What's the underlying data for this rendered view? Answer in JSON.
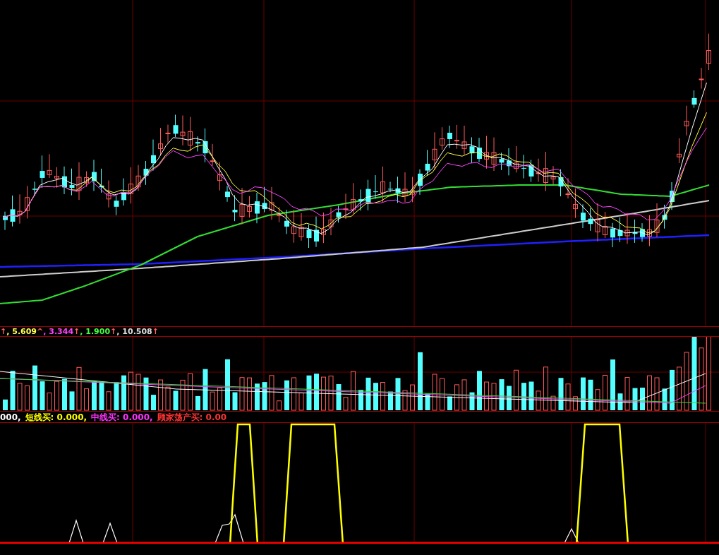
{
  "volume_legend": {
    "lead": "↑",
    "items": [
      {
        "text": ", 5.609",
        "mark": "^"
      },
      {
        "text": ", 3.344",
        "mark": "↑"
      },
      {
        "text": ", 1.900",
        "mark": "↑"
      },
      {
        "text": ", 10.508",
        "mark": "↑"
      }
    ]
  },
  "indicator_legend": {
    "items": [
      {
        "text": "000,"
      },
      {
        "text": "短线买: 0.000,"
      },
      {
        "text": "中线买: 0.000,"
      },
      {
        "text": "顾家荡产买: 0.00"
      }
    ]
  }
}
